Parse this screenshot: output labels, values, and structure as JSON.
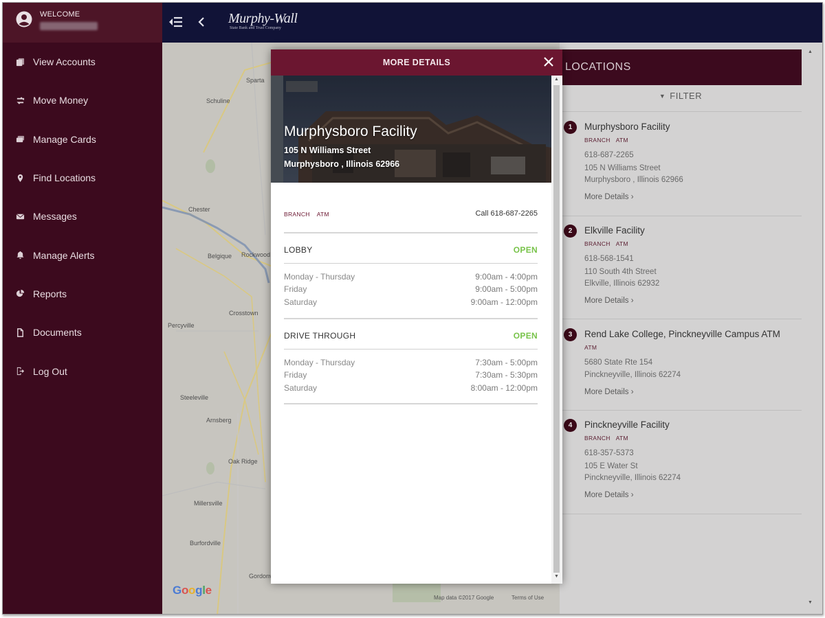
{
  "header": {
    "welcome_label": "WELCOME",
    "logo_name": "Murphy-Wall",
    "logo_subtitle": "State Bank and Trust Company"
  },
  "sidebar": {
    "items": [
      {
        "label": "View Accounts",
        "icon": "accounts-icon"
      },
      {
        "label": "Move Money",
        "icon": "transfer-icon"
      },
      {
        "label": "Manage Cards",
        "icon": "card-icon"
      },
      {
        "label": "Find Locations",
        "icon": "map-pin-icon"
      },
      {
        "label": "Messages",
        "icon": "envelope-icon"
      },
      {
        "label": "Manage Alerts",
        "icon": "bell-icon"
      },
      {
        "label": "Reports",
        "icon": "pie-chart-icon"
      },
      {
        "label": "Documents",
        "icon": "document-icon"
      },
      {
        "label": "Log Out",
        "icon": "logout-icon"
      }
    ]
  },
  "map": {
    "labels": [
      "Sparta",
      "Schuline",
      "Chester",
      "Belgique",
      "Rockwood",
      "Crosstown",
      "Percyville",
      "Steeleville",
      "Arnsberg",
      "Oak Ridge",
      "Millersville",
      "Burfordville",
      "Gordonville"
    ],
    "attribution": "Map data ©2017 Google",
    "terms": "Terms of Use",
    "google_logo": "Google"
  },
  "modal": {
    "title": "MORE DETAILS",
    "location_name": "Murphysboro Facility",
    "street": "105 N Williams Street",
    "city": "Murphysboro , Illinois 62966",
    "tags": [
      "BRANCH",
      "ATM"
    ],
    "call_label": "Call",
    "phone": "618-687-2265",
    "sections": [
      {
        "title": "LOBBY",
        "status": "OPEN",
        "hours": [
          {
            "days": "Monday - Thursday",
            "time": "9:00am - 4:00pm"
          },
          {
            "days": "Friday",
            "time": "9:00am - 5:00pm"
          },
          {
            "days": "Saturday",
            "time": "9:00am - 12:00pm"
          }
        ]
      },
      {
        "title": "DRIVE THROUGH",
        "status": "OPEN",
        "hours": [
          {
            "days": "Monday - Thursday",
            "time": "7:30am - 5:00pm"
          },
          {
            "days": "Friday",
            "time": "7:30am - 5:30pm"
          },
          {
            "days": "Saturday",
            "time": "8:00am - 12:00pm"
          }
        ]
      }
    ]
  },
  "locations": {
    "title": "LOCATIONS",
    "filter_label": "FILTER",
    "more_label": "More Details",
    "items": [
      {
        "num": "1",
        "name": "Murphysboro Facility",
        "tags": [
          "BRANCH",
          "ATM"
        ],
        "phone": "618-687-2265",
        "street": "105 N Williams Street",
        "city": "Murphysboro , Illinois 62966"
      },
      {
        "num": "2",
        "name": "Elkville Facility",
        "tags": [
          "BRANCH",
          "ATM"
        ],
        "phone": "618-568-1541",
        "street": "110 South 4th Street",
        "city": "Elkville, Illinois 62932"
      },
      {
        "num": "3",
        "name": "Rend Lake College, Pinckneyville Campus ATM",
        "tags": [
          "ATM"
        ],
        "phone": "",
        "street": "5680 State Rte 154",
        "city": "Pinckneyville, Illinois 62274"
      },
      {
        "num": "4",
        "name": "Pinckneyville Facility",
        "tags": [
          "BRANCH",
          "ATM"
        ],
        "phone": "618-357-5373",
        "street": "105 E Water St",
        "city": "Pinckneyville, Illinois 62274"
      }
    ]
  },
  "colors": {
    "sidebar": "#3c0a1e",
    "header": "#111337",
    "modal_header": "#6b1630",
    "open_status": "#78c34a"
  }
}
